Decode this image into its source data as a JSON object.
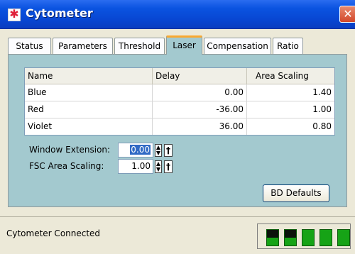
{
  "window": {
    "title": "Cytometer",
    "close_glyph": "✕",
    "icon_glyph": "✱"
  },
  "tabs": [
    {
      "label": "Status"
    },
    {
      "label": "Parameters"
    },
    {
      "label": "Threshold"
    },
    {
      "label": "Laser",
      "active": true
    },
    {
      "label": "Compensation"
    },
    {
      "label": "Ratio"
    }
  ],
  "laser_table": {
    "headers": [
      "Name",
      "Delay",
      "Area Scaling"
    ],
    "rows": [
      [
        "Blue",
        "0.00",
        "1.40"
      ],
      [
        "Red",
        "-36.00",
        "1.00"
      ],
      [
        "Violet",
        "36.00",
        "0.80"
      ]
    ]
  },
  "settings": {
    "window_extension_label": "Window Extension:",
    "window_extension_value": "0.00",
    "fsc_area_scaling_label": "FSC Area Scaling:",
    "fsc_area_scaling_value": "1.00",
    "pin_glyph": "†"
  },
  "buttons": {
    "bd_defaults": "BD Defaults"
  },
  "status": {
    "text": "Cytometer Connected",
    "leds": [
      {
        "state": "half"
      },
      {
        "state": "half"
      },
      {
        "state": "on"
      },
      {
        "state": "on"
      },
      {
        "state": "on"
      }
    ],
    "led_color": "#16a316"
  },
  "colors": {
    "panel": "#a3c9cf",
    "title_bar": "#0a53e0",
    "active_tab_accent": "#f8a830"
  }
}
